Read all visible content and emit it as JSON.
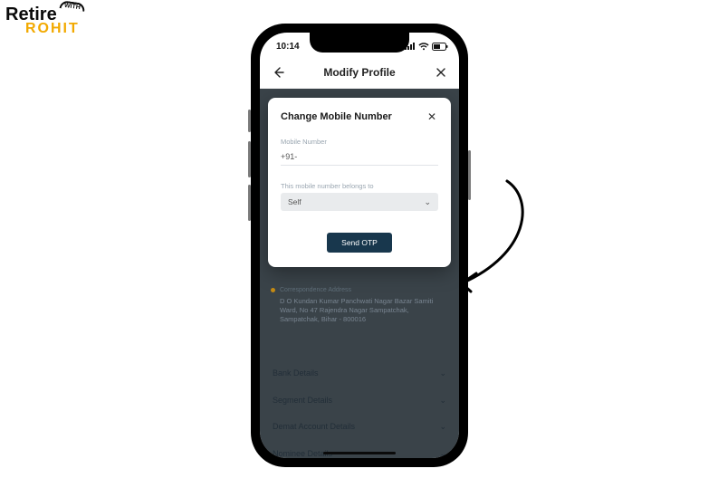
{
  "logo": {
    "line1": "Retire",
    "line2": "ROHIT",
    "badge": "WITH"
  },
  "statusbar": {
    "time": "10:14"
  },
  "header": {
    "title": "Modify Profile"
  },
  "modal": {
    "title": "Change Mobile Number",
    "mobile_label": "Mobile Number",
    "mobile_value": "+91-",
    "belongs_label": "This mobile number belongs to",
    "belongs_value": "Self",
    "send_otp": "Send OTP"
  },
  "background": {
    "address_title": "Correspondence Address",
    "address_lines": "D O Kundan Kumar Panchwati Nagar Bazar Samiti Ward, No 47 Rajendra Nagar Sampatchak, Sampatchak, Bihar - 800016",
    "sections": [
      "Bank Details",
      "Segment Details",
      "Demat Account Details",
      "Nominee Details"
    ]
  }
}
